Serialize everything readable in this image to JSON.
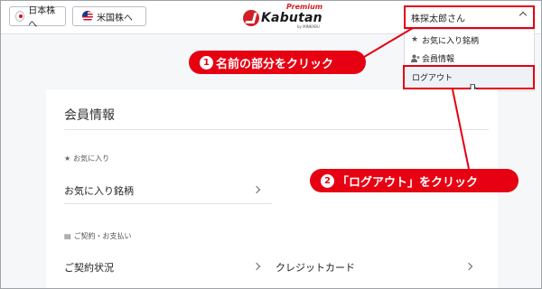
{
  "header": {
    "market_buttons": [
      {
        "label": "日本株へ",
        "flag": "japan-flag-icon"
      },
      {
        "label": "米国株へ",
        "flag": "us-flag-icon"
      }
    ],
    "logo": {
      "brand": "Kabutan",
      "premium": "Premium",
      "byline": "by MINKABU"
    },
    "user_menu": {
      "label": "株探太郎さん",
      "icon": "chevron-up-icon"
    }
  },
  "dropdown": {
    "items": [
      {
        "label": "お気に入り銘柄",
        "icon": "star-icon"
      },
      {
        "label": "会員情報",
        "icon": "user-icon"
      },
      {
        "label": "ログアウト",
        "icon": ""
      }
    ]
  },
  "main": {
    "title": "会員情報",
    "sections": [
      {
        "label": "お気に入り",
        "icon": "star-icon",
        "rows": [
          {
            "label": "お気に入り銘柄"
          }
        ]
      },
      {
        "label": "ご契約・お支払い",
        "icon": "document-icon",
        "rows": [
          {
            "label": "ご契約状況"
          },
          {
            "label": "クレジットカード"
          }
        ]
      }
    ]
  },
  "callouts": [
    {
      "number": "1",
      "text": "名前の部分をクリック"
    },
    {
      "number": "2",
      "text": "「ログアウト」をクリック"
    }
  ],
  "colors": {
    "accent": "#e60012",
    "brand": "#d21f26"
  }
}
